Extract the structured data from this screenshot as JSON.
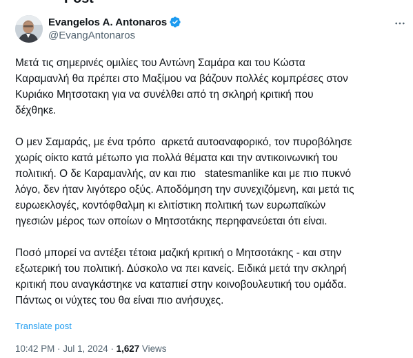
{
  "page_title": "Post",
  "author": {
    "name": "Evangelos A. Antonaros",
    "handle": "@EvangAntonaros",
    "verified": true,
    "verified_color": "#1d9bf0"
  },
  "more_icon": "more-horizontal-icon",
  "tweet": {
    "paragraphs": [
      [
        "Μετά τις σημερινές ομιλίες του Αντώνη Σαμάρα και του Κώστα",
        "Καραμανλή θα πρέπει στο Μαξίμου να βάζουν πολλές κομπρέσες στον",
        "Κυριάκο Μητσοτακη για να συνέλθει από τη σκληρή κριτική που",
        "δέχθηκε."
      ],
      [
        "Ο μεν Σαμαράς, με ένα τρόπο  αρκετά αυτοαναφορικό, τον πυροβόλησε",
        "χωρίς οίκτο κατά μέτωπο για πολλά θέματα και την αντικοινωνική του",
        "πολιτική. Ο δε Καραμανλής, αν και πιο   statesmanlike και με πιο πυκνό",
        "λόγο, δεν ήταν λιγότερο οξύς. Αποδόμηση την συνεχιζόμενη, και μετά τις",
        "ευρωεκλογές, κοντόφθαλμη κι ελιτίστικη πολιτική των ευρωπαϊκών",
        "ηγεσιών μέρος των οποίων ο Μητσοτάκης περηφανεύεται ότι είναι."
      ],
      [
        "Ποσό μπορεί να αντέξει τέτοια μαζική κριτική ο Μητσοτάκης - και στην",
        "εξωτερική του πολιτική. Δύσκολο να πει κανείς. Ειδικά μετά την σκληρή",
        "κριτική που αναγκάστηκε να καταπιεί στην κοινοβουλευτική του ομάδα.",
        "Πάντως οι νύχτες του θα είναι πιο ανήσυχες."
      ]
    ],
    "translate_label": "Translate post",
    "time": "10:42 PM",
    "date": "Jul 1, 2024",
    "separator": " · ",
    "views_count": "1,627",
    "views_label": "Views"
  }
}
